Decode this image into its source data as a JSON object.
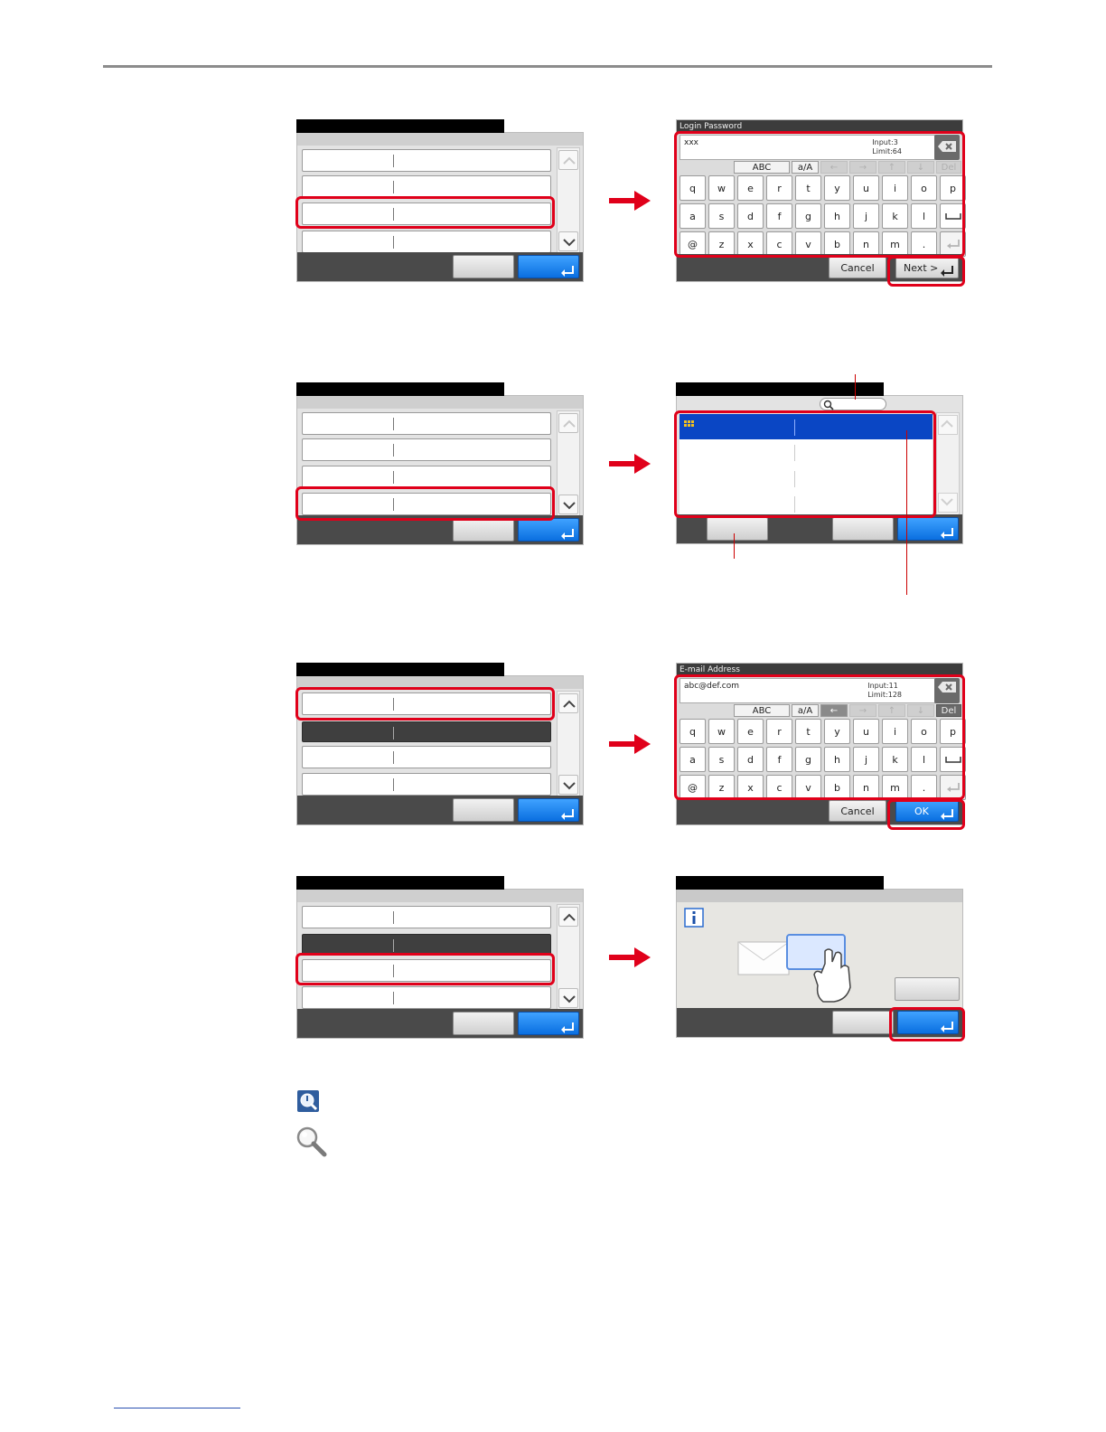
{
  "kbd_password": {
    "title": "Login Password",
    "input_value": "xxx",
    "input_count": "Input:3",
    "input_limit": "Limit:64",
    "del_label": "Del",
    "mode_label": "ABC",
    "case_label": "a/A",
    "row1": [
      "q",
      "w",
      "e",
      "r",
      "t",
      "y",
      "u",
      "i",
      "o",
      "p"
    ],
    "row2": [
      "a",
      "s",
      "d",
      "f",
      "g",
      "h",
      "j",
      "k",
      "l"
    ],
    "row3": [
      "@",
      "z",
      "x",
      "c",
      "v",
      "b",
      "n",
      "m",
      "."
    ],
    "cancel_label": "Cancel",
    "next_label": "Next >"
  },
  "kbd_email": {
    "title": "E-mail Address",
    "input_value": "abc@def.com",
    "input_count": "Input:11",
    "input_limit": "Limit:128",
    "del_label": "Del",
    "mode_label": "ABC",
    "case_label": "a/A",
    "row1": [
      "q",
      "w",
      "e",
      "r",
      "t",
      "y",
      "u",
      "i",
      "o",
      "p"
    ],
    "row2": [
      "a",
      "s",
      "d",
      "f",
      "g",
      "h",
      "j",
      "k",
      "l"
    ],
    "row3": [
      "@",
      "z",
      "x",
      "c",
      "v",
      "b",
      "n",
      "m",
      "."
    ],
    "cancel_label": "Cancel",
    "ok_label": "OK"
  },
  "colors": {
    "highlight": "#e0001a",
    "arrow": "#e0001a",
    "accent_blue": "#0a6fe0",
    "selected_row": "#0a46c4"
  },
  "icons": [
    "arrow-right-icon",
    "enter-icon",
    "backspace-icon",
    "search-icon",
    "info-icon",
    "hand-card-icon",
    "note-icon",
    "magnifier-icon"
  ]
}
